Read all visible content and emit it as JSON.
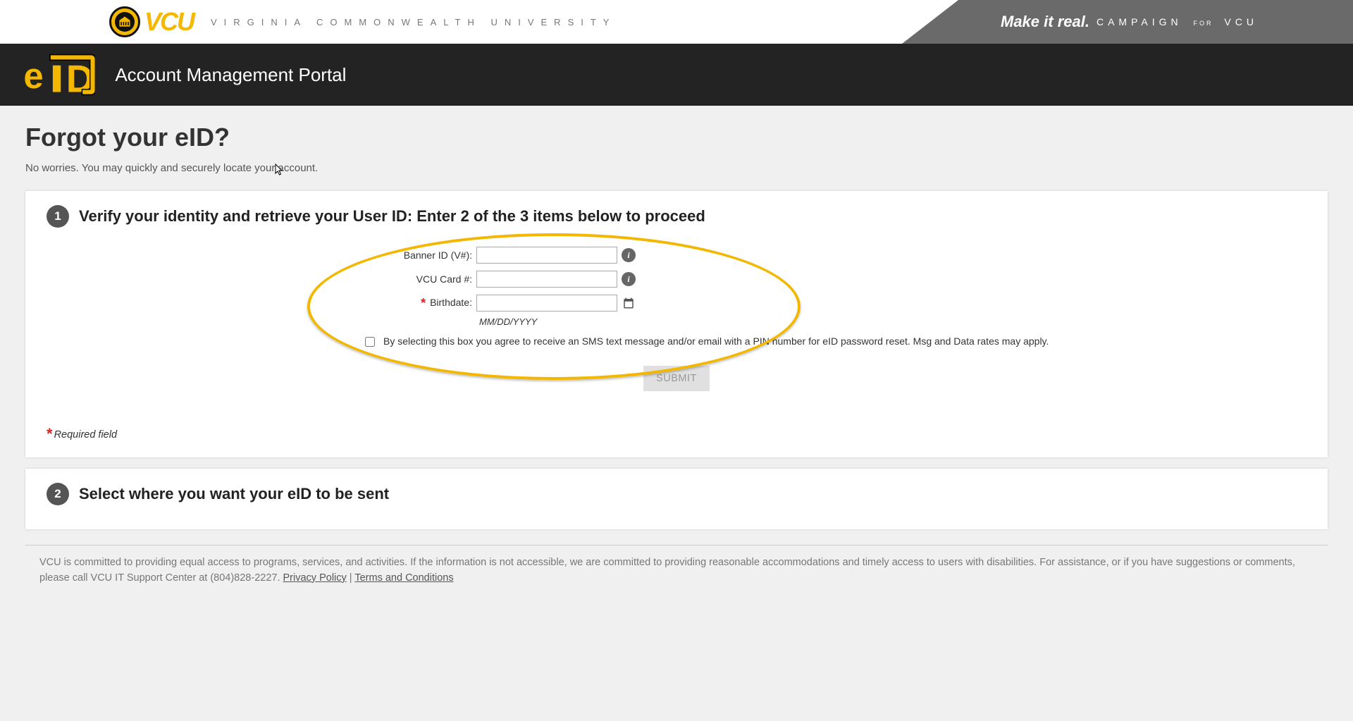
{
  "topbar": {
    "wordmark": "VCU",
    "univ_name": "VIRGINIA COMMONWEALTH UNIVERSITY",
    "campaign_strong": "Make it real.",
    "campaign_word": "CAMPAIGN",
    "campaign_for": "FOR",
    "campaign_vcu": "VCU"
  },
  "portal": {
    "title": "Account Management Portal"
  },
  "page": {
    "heading": "Forgot your eID?",
    "subtext": "No worries. You may quickly and securely locate your account."
  },
  "step1": {
    "num": "1",
    "title": "Verify your identity and retrieve your User ID: Enter 2 of the 3 items below to proceed",
    "fields": {
      "banner_label": "Banner ID (V#):",
      "card_label": "VCU Card #:",
      "birth_label": "Birthdate:",
      "birth_hint": "MM/DD/YYYY"
    },
    "consent": "By selecting this box you agree to receive an SMS text message and/or email with a PIN number for eID password reset. Msg and Data rates may apply.",
    "submit_label": "SUBMIT",
    "req_note": "Required field"
  },
  "step2": {
    "num": "2",
    "title": "Select where you want your eID to be sent"
  },
  "footer": {
    "text1": "VCU is committed to providing equal access to programs, services, and activities. If the information is not accessible, we are committed to providing reasonable accommodations and timely access to users with disabilities. For assistance, or if you have suggestions or comments, please call VCU IT Support Center at (804)828-2227. ",
    "privacy": "Privacy Policy",
    "sep": " | ",
    "terms": "Terms and Conditions"
  }
}
